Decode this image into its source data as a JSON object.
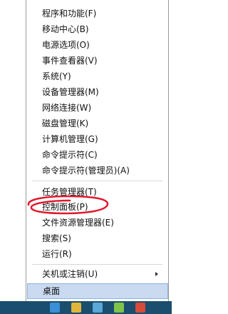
{
  "menu": {
    "groups": [
      [
        "程序和功能(F)",
        "移动中心(B)",
        "电源选项(O)",
        "事件查看器(V)",
        "系统(Y)",
        "设备管理器(M)",
        "网络连接(W)",
        "磁盘管理(K)",
        "计算机管理(G)",
        "命令提示符(C)",
        "命令提示符(管理员)(A)"
      ],
      [
        "任务管理器(T)",
        "控制面板(P)",
        "文件资源管理器(E)",
        "搜索(S)",
        "运行(R)"
      ],
      [
        "关机或注销(U)"
      ]
    ],
    "desktop_label": "桌面"
  },
  "colors": {
    "highlight_circle": "#e0192c",
    "selected_bg": "#c9daf1",
    "taskbar": "#1a4d6e"
  }
}
